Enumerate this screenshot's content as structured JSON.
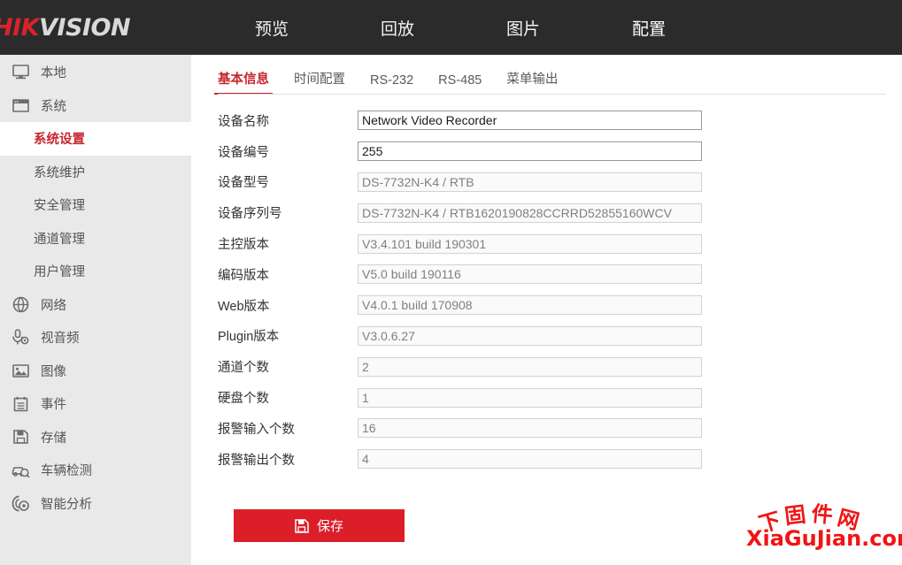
{
  "header": {
    "logo_hik": "HIK",
    "logo_vision": "VISION",
    "nav": [
      {
        "label": "预览",
        "active": false
      },
      {
        "label": "回放",
        "active": false
      },
      {
        "label": "图片",
        "active": false
      },
      {
        "label": "配置",
        "active": true
      }
    ]
  },
  "sidebar": {
    "items": [
      {
        "label": "本地",
        "icon": "monitor-icon"
      },
      {
        "label": "系统",
        "icon": "window-icon"
      }
    ],
    "subitems": [
      {
        "label": "系统设置",
        "active": true
      },
      {
        "label": "系统维护",
        "active": false
      },
      {
        "label": "安全管理",
        "active": false
      },
      {
        "label": "通道管理",
        "active": false
      },
      {
        "label": "用户管理",
        "active": false
      }
    ],
    "items2": [
      {
        "label": "网络",
        "icon": "globe-icon"
      },
      {
        "label": "视音频",
        "icon": "microphone-icon"
      },
      {
        "label": "图像",
        "icon": "picture-icon"
      },
      {
        "label": "事件",
        "icon": "list-icon"
      },
      {
        "label": "存储",
        "icon": "floppy-disk-icon"
      },
      {
        "label": "车辆检测",
        "icon": "car-search-icon"
      },
      {
        "label": "智能分析",
        "icon": "smart-analysis-icon"
      }
    ]
  },
  "main": {
    "tabs": [
      {
        "label": "基本信息",
        "active": true
      },
      {
        "label": "时间配置",
        "active": false
      },
      {
        "label": "RS-232",
        "active": false
      },
      {
        "label": "RS-485",
        "active": false
      },
      {
        "label": "菜单输出",
        "active": false
      }
    ],
    "fields": [
      {
        "label": "设备名称",
        "value": "Network Video Recorder",
        "disabled": false
      },
      {
        "label": "设备编号",
        "value": "255",
        "disabled": false
      },
      {
        "label": "设备型号",
        "value": "DS-7732N-K4 / RTB",
        "disabled": true
      },
      {
        "label": "设备序列号",
        "value": "DS-7732N-K4 / RTB1620190828CCRRD52855160WCV",
        "disabled": true
      },
      {
        "label": "主控版本",
        "value": "V3.4.101 build 190301",
        "disabled": true
      },
      {
        "label": "编码版本",
        "value": "V5.0 build 190116",
        "disabled": true
      },
      {
        "label": "Web版本",
        "value": "V4.0.1 build 170908",
        "disabled": true
      },
      {
        "label": "Plugin版本",
        "value": "V3.0.6.27",
        "disabled": true
      },
      {
        "label": "通道个数",
        "value": "2",
        "disabled": true
      },
      {
        "label": "硬盘个数",
        "value": "1",
        "disabled": true
      },
      {
        "label": "报警输入个数",
        "value": "16",
        "disabled": true
      },
      {
        "label": "报警输出个数",
        "value": "4",
        "disabled": true
      }
    ],
    "save_label": "保存"
  },
  "watermark": {
    "cn_chars": [
      "下",
      "固",
      "件",
      "网"
    ],
    "en_text": "XiaGuJian.com",
    "color": "#f01414"
  },
  "colors": {
    "brand_red": "#c8262d",
    "button_red": "#dc1e28",
    "header_bg": "#2b2b2b",
    "sidebar_bg": "#e9e9e9"
  }
}
